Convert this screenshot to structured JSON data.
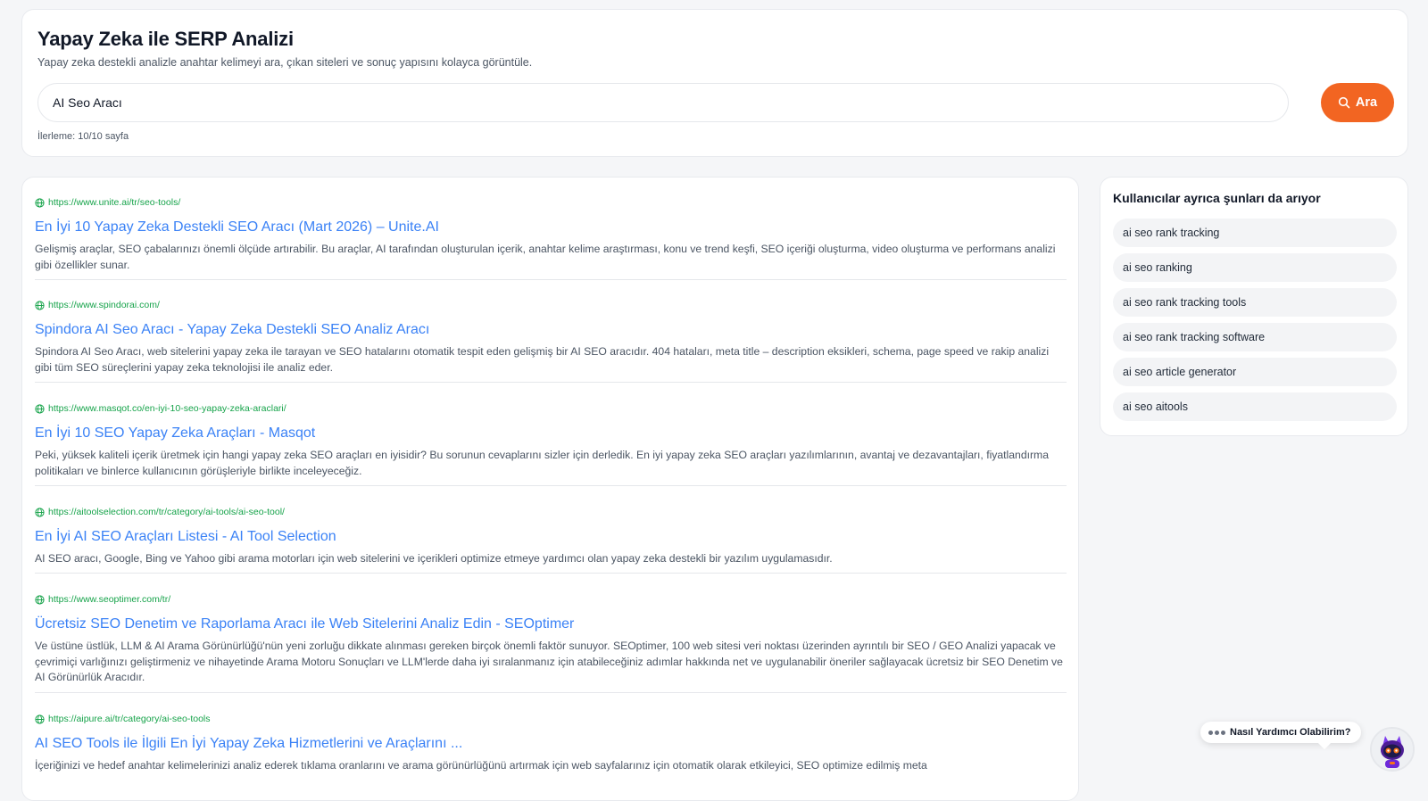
{
  "header": {
    "title": "Yapay Zeka ile SERP Analizi",
    "subtitle": "Yapay zeka destekli analizle anahtar kelimeyi ara, çıkan siteleri ve sonuç yapısını kolayca görüntüle."
  },
  "search": {
    "value": "AI Seo Aracı",
    "button_label": "Ara",
    "progress": "İlerleme: 10/10 sayfa"
  },
  "results": [
    {
      "url": "https://www.unite.ai/tr/seo-tools/",
      "title": "En İyi 10 Yapay Zeka Destekli SEO Aracı (Mart 2026) – Unite.AI",
      "description": "Gelişmiş araçlar, SEO çabalarınızı önemli ölçüde artırabilir. Bu araçlar, AI tarafından oluşturulan içerik, anahtar kelime araştırması, konu ve trend keşfi, SEO içeriği oluşturma, video oluşturma ve performans analizi gibi özellikler sunar."
    },
    {
      "url": "https://www.spindorai.com/",
      "title": "Spindora AI Seo Aracı - Yapay Zeka Destekli SEO Analiz Aracı",
      "description": "Spindora AI Seo Aracı, web sitelerini yapay zeka ile tarayan ve SEO hatalarını otomatik tespit eden gelişmiş bir AI SEO aracıdır. 404 hataları, meta title – description eksikleri, schema, page speed ve rakip analizi gibi tüm SEO süreçlerini yapay zeka teknolojisi ile analiz eder."
    },
    {
      "url": "https://www.masqot.co/en-iyi-10-seo-yapay-zeka-araclari/",
      "title": "En İyi 10 SEO Yapay Zeka Araçları - Masqot",
      "description": "Peki, yüksek kaliteli içerik üretmek için hangi yapay zeka SEO araçları en iyisidir? Bu sorunun cevaplarını sizler için derledik. En iyi yapay zeka SEO araçları yazılımlarının, avantaj ve dezavantajları, fiyatlandırma politikaları ve binlerce kullanıcının görüşleriyle birlikte inceleyeceğiz."
    },
    {
      "url": "https://aitoolselection.com/tr/category/ai-tools/ai-seo-tool/",
      "title": "En İyi AI SEO Araçları Listesi - AI Tool Selection",
      "description": "AI SEO aracı, Google, Bing ve Yahoo gibi arama motorları için web sitelerini ve içerikleri optimize etmeye yardımcı olan yapay zeka destekli bir yazılım uygulamasıdır."
    },
    {
      "url": "https://www.seoptimer.com/tr/",
      "title": "Ücretsiz SEO Denetim ve Raporlama Aracı ile Web Sitelerini Analiz Edin - SEOptimer",
      "description": "Ve üstüne üstlük, LLM & AI Arama Görünürlüğü'nün yeni zorluğu dikkate alınması gereken birçok önemli faktör sunuyor. SEOptimer, 100 web sitesi veri noktası üzerinden ayrıntılı bir SEO / GEO Analizi yapacak ve çevrimiçi varlığınızı geliştirmeniz ve nihayetinde Arama Motoru Sonuçları ve LLM'lerde daha iyi sıralanmanız için atabileceğiniz adımlar hakkında net ve uygulanabilir öneriler sağlayacak ücretsiz bir SEO Denetim ve AI Görünürlük Aracıdır."
    },
    {
      "url": "https://aipure.ai/tr/category/ai-seo-tools",
      "title": "AI SEO Tools ile İlgili En İyi Yapay Zeka Hizmetlerini ve Araçlarını ...",
      "description": "İçeriğinizi ve hedef anahtar kelimelerinizi analiz ederek tıklama oranlarını ve arama görünürlüğünü artırmak için web sayfalarınız için otomatik olarak etkileyici, SEO optimize edilmiş meta"
    }
  ],
  "related": {
    "title": "Kullanıcılar ayrıca şunları da arıyor",
    "items": [
      "ai seo rank tracking",
      "ai seo ranking",
      "ai seo rank tracking tools",
      "ai seo rank tracking software",
      "ai seo article generator",
      "ai seo aitools"
    ]
  },
  "chat": {
    "prompt": "Nasıl Yardımcı Olabilirim?",
    "icons": {
      "dots": "typing-dots-icon",
      "avatar": "robot-avatar-icon"
    }
  },
  "colors": {
    "accent": "#f26522",
    "link": "#3b82f6",
    "url": "#16a34a"
  }
}
